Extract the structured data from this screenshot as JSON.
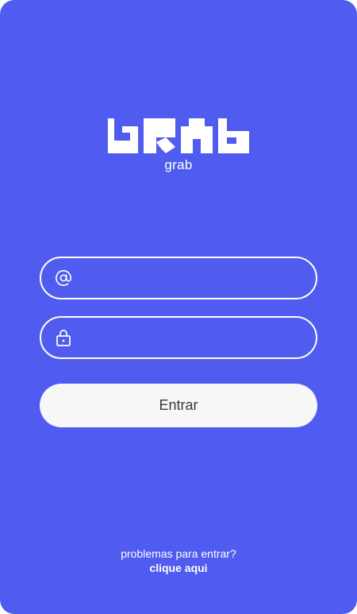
{
  "brand": {
    "logo_text": "GRAB",
    "name": "grab"
  },
  "form": {
    "email_placeholder": "",
    "email_icon": "at-icon",
    "password_placeholder": "",
    "password_icon": "lock-icon",
    "submit_label": "Entrar"
  },
  "help": {
    "question": "problemas para entrar?",
    "link_label": "clique aqui"
  },
  "colors": {
    "background": "#4f5cef",
    "button_bg": "#f7f7f8",
    "foreground": "#ffffff"
  }
}
